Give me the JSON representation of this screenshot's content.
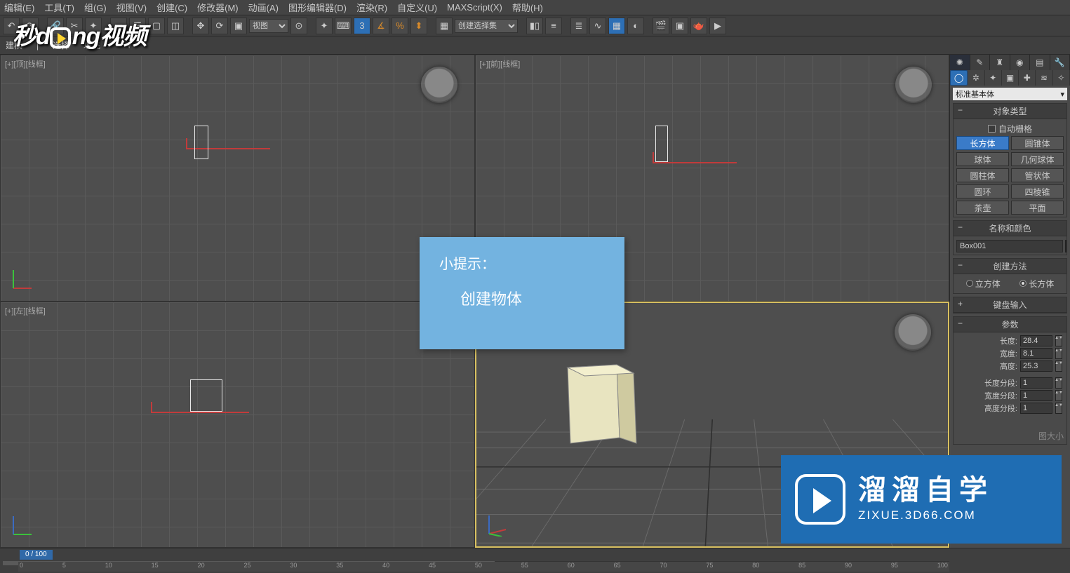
{
  "menu": [
    "编辑(E)",
    "工具(T)",
    "组(G)",
    "视图(V)",
    "创建(C)",
    "修改器(M)",
    "动画(A)",
    "图形编辑器(D)",
    "渲染(R)",
    "自定义(U)",
    "MAXScript(X)",
    "帮助(H)"
  ],
  "toolbar": {
    "view_dd": "视图",
    "selset_dd": "创建选择集"
  },
  "toolbar2": {
    "model": "建模",
    "select": "选择",
    "fill": "填充"
  },
  "viewports": {
    "top": "[+][顶][线框]",
    "front": "[+][前][线框]",
    "left": "[+][左][线框]",
    "persp": "[+][透视][真实]"
  },
  "tip": {
    "title": "小提示：",
    "body": "创建物体"
  },
  "wm1": "秒dong视频",
  "wm2": {
    "big": "溜溜自学",
    "small": "ZIXUE.3D66.COM"
  },
  "panel": {
    "primset_dd": "标准基本体",
    "objtype_title": "对象类型",
    "autogrid": "自动栅格",
    "prims": [
      "长方体",
      "圆锥体",
      "球体",
      "几何球体",
      "圆柱体",
      "管状体",
      "圆环",
      "四棱锥",
      "茶壶",
      "平面"
    ],
    "namecolor_title": "名称和颜色",
    "obj_name": "Box001",
    "create_title": "创建方法",
    "create_opts": [
      "立方体",
      "长方体"
    ],
    "kb_title": "键盘输入",
    "param_title": "参数",
    "len_lbl": "长度:",
    "len_val": "28.4",
    "wid_lbl": "宽度:",
    "wid_val": "8.1",
    "hei_lbl": "高度:",
    "hei_val": "25.3",
    "lseg_lbl": "长度分段:",
    "lseg_val": "1",
    "wseg_lbl": "宽度分段:",
    "wseg_val": "1",
    "hseg_lbl": "高度分段:",
    "hseg_val": "1",
    "mapsize": "图大小"
  },
  "status": {
    "frame": "0 / 100",
    "ticks": [
      "0",
      "5",
      "10",
      "15",
      "20",
      "25",
      "30",
      "35",
      "40",
      "45",
      "50",
      "55",
      "60",
      "65",
      "70",
      "75",
      "80",
      "85",
      "90",
      "95",
      "100"
    ]
  }
}
